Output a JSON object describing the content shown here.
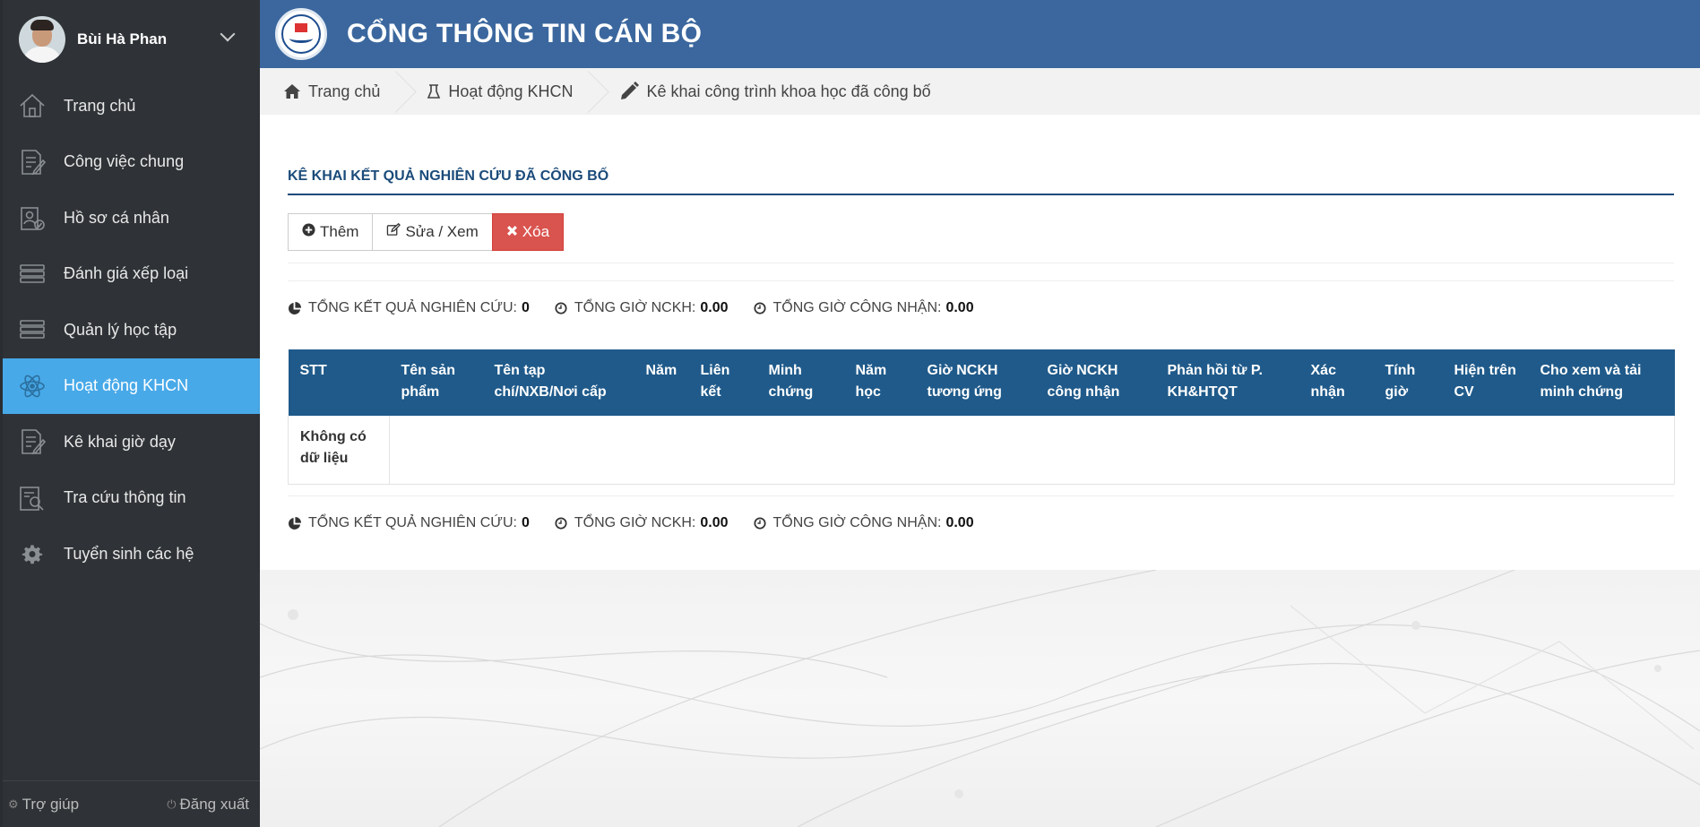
{
  "user": {
    "name": "Bùi Hà Phan"
  },
  "sidebar": {
    "items": [
      {
        "label": "Trang chủ",
        "icon": "home-icon",
        "active": false
      },
      {
        "label": "Công việc chung",
        "icon": "document-edit-icon",
        "active": false
      },
      {
        "label": "Hồ sơ cá nhân",
        "icon": "profile-file-icon",
        "active": false
      },
      {
        "label": "Đánh giá xếp loại",
        "icon": "stack-icon",
        "active": false
      },
      {
        "label": "Quản lý học tập",
        "icon": "stack-icon",
        "active": false
      },
      {
        "label": "Hoạt động KHCN",
        "icon": "atom-icon",
        "active": true
      },
      {
        "label": "Kê khai giờ dạy",
        "icon": "document-edit-icon",
        "active": false
      },
      {
        "label": "Tra cứu thông tin",
        "icon": "search-document-icon",
        "active": false
      },
      {
        "label": "Tuyển sinh các hệ",
        "icon": "gear-icon",
        "active": false
      }
    ],
    "footer": {
      "help": "Trợ giúp",
      "logout": "Đăng xuất"
    }
  },
  "header": {
    "title": "CỔNG THÔNG TIN CÁN BỘ"
  },
  "breadcrumb": {
    "home": "Trang chủ",
    "section": "Hoạt động KHCN",
    "current": "Kê khai công trình khoa học đã công bố"
  },
  "main": {
    "section_title": "KÊ KHAI KẾT QUẢ NGHIÊN CỨU ĐÃ CÔNG BỐ",
    "buttons": {
      "add": "Thêm",
      "edit": "Sửa / Xem",
      "delete": "Xóa"
    },
    "summary": {
      "total_results_label": "TỔNG KẾT QUẢ NGHIÊN CỨU:",
      "total_results": "0",
      "total_hours_label": "TỔNG GIỜ NCKH:",
      "total_hours": "0.00",
      "approved_hours_label": "TỔNG GIỜ CÔNG NHẬN:",
      "approved_hours": "0.00"
    },
    "table": {
      "headers": [
        "STT",
        "Tên sản phẩm",
        "Tên tạp chí/NXB/Nơi cấp",
        "Năm",
        "Liên kết",
        "Minh chứng",
        "Năm học",
        "Giờ NCKH tương ứng",
        "Giờ NCKH công nhận",
        "Phản hồi từ P. KH&HTQT",
        "Xác nhận",
        "Tính giờ",
        "Hiện trên CV",
        "Cho xem và tải minh chứng"
      ],
      "empty_text": "Không có dữ liệu"
    }
  },
  "colors": {
    "sidebar_bg": "#2f3337",
    "active": "#48a9e8",
    "header": "#3b679e",
    "table_header": "#1f5a8a",
    "danger": "#d9534f"
  }
}
